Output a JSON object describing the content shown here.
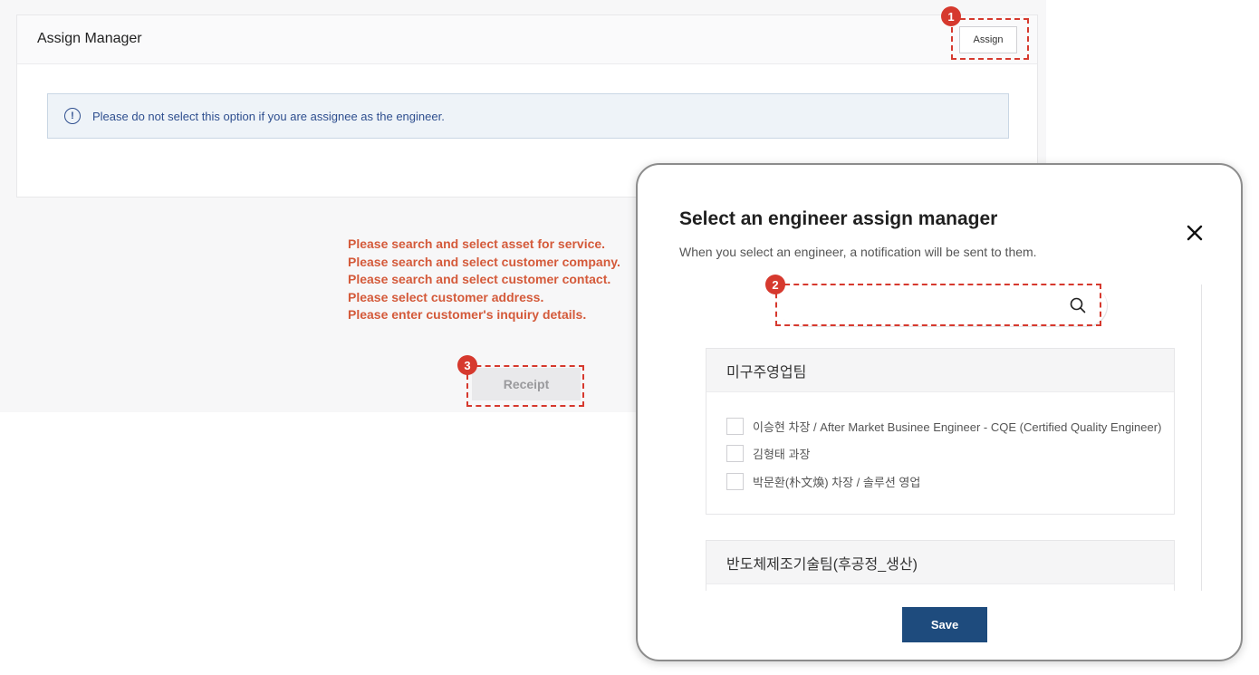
{
  "card": {
    "title": "Assign Manager",
    "assign_label": "Assign",
    "alert_icon": "!",
    "alert_text": "Please do not select this option if you are assignee as the engineer."
  },
  "errors": [
    "Please search and select asset for service.",
    "Please search and select customer company.",
    "Please search and select customer contact.",
    "Please select customer address.",
    "Please enter customer's inquiry details."
  ],
  "receipt_label": "Receipt",
  "callouts": {
    "badge1": "1",
    "badge2": "2",
    "badge3": "3"
  },
  "modal": {
    "title": "Select an engineer assign manager",
    "subtitle": "When you select an engineer, a notification will be sent to them.",
    "search_placeholder": "",
    "groups": [
      {
        "name": "미구주영업팀",
        "members": [
          "이승현 차장 / After Market Businee Engineer - CQE (Certified Quality Engineer)",
          "김형태 과장",
          "박문환(朴文煥) 차장 / 솔루션 영업"
        ]
      },
      {
        "name": "반도체제조기술팀(후공정_생산)",
        "members": []
      }
    ],
    "save_label": "Save"
  },
  "icons": {
    "info": "info-circle-icon",
    "close": "close-icon",
    "search": "search-icon"
  },
  "colors": {
    "callout": "#d6392e",
    "error_text": "#d45a3a",
    "alert_text": "#2f4f8f",
    "save_button": "#1e4b7d"
  }
}
